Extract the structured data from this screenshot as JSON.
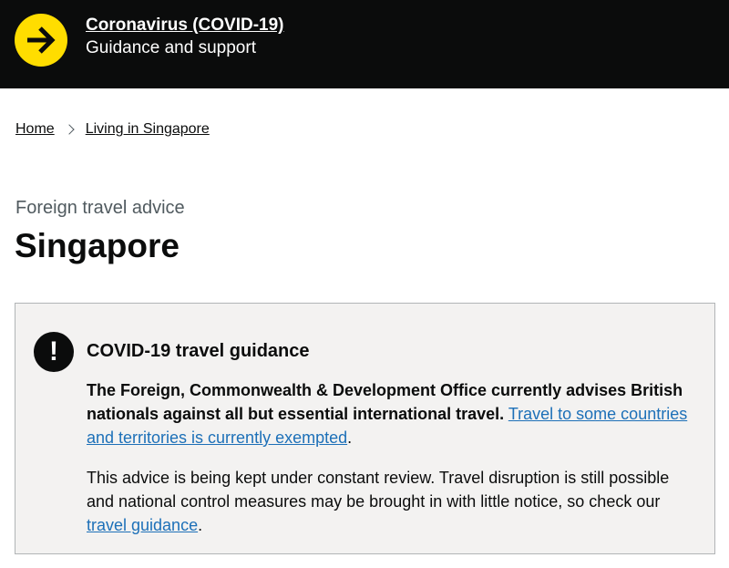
{
  "banner": {
    "icon": "arrow-right-icon",
    "title": "Coronavirus (COVID-19)",
    "subtitle": "Guidance and support",
    "colors": {
      "background": "#0b0c0c",
      "icon_circle": "#ffdd00"
    }
  },
  "breadcrumbs": [
    {
      "label": "Home"
    },
    {
      "label": "Living in Singapore"
    }
  ],
  "header": {
    "caption": "Foreign travel advice",
    "title": "Singapore"
  },
  "notice": {
    "icon": "exclamation-icon",
    "heading": "COVID-19 travel guidance",
    "p1_bold": "The Foreign, Commonwealth & Development Office currently advises British nationals against all but essential international travel.",
    "p1_link": "Travel to some countries and territories is currently exempted",
    "p1_end": ".",
    "p2_text": "This advice is being kept under constant review. Travel disruption is still possible and national control measures may be brought in with little notice, so check our",
    "p2_link": "travel guidance",
    "p2_end": ".",
    "colors": {
      "background": "#f3f2f1",
      "link": "#1d70b8"
    }
  }
}
